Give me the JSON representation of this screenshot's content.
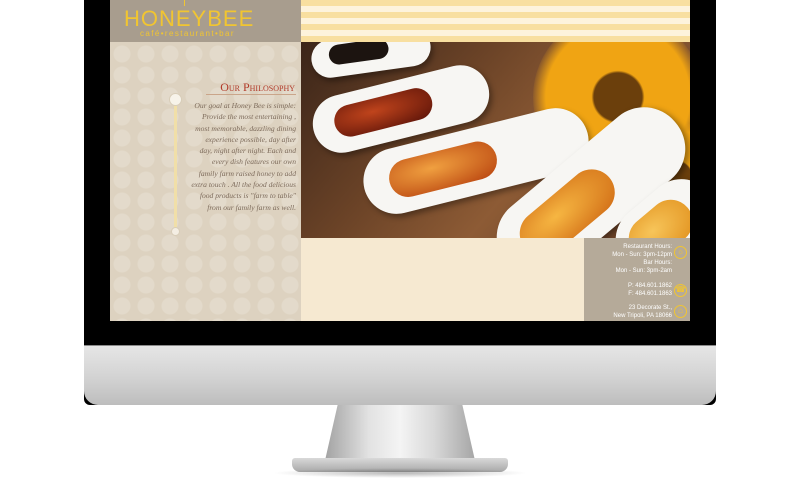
{
  "brand": {
    "name": "HONEYBEE",
    "tagline": "café•restaurant•bar",
    "accent_color": "#f1c531"
  },
  "philosophy": {
    "title": "Our Philosophy",
    "lines": [
      "Our goal at Honey Bee is simple:",
      "Provide the most entertaining ,",
      "most memorable, dazzling dining",
      "experience possible, day after",
      "day, night after night.  Each and",
      "every dish features our own",
      "family farm raised honey to add",
      "extra touch . All the food delicious",
      "food products is \"farm to table\"",
      "from our family farm as well."
    ]
  },
  "info": {
    "restaurant_hours_label": "Restaurant Hours:",
    "restaurant_hours": "Mon - Sun: 3pm-12pm",
    "bar_hours_label": "Bar Hours:",
    "bar_hours": "Mon - Sun: 3pm-2am",
    "phone": "P: 484.601.1862",
    "fax": "F: 484.601.1863",
    "address_line1": "23 Decorate St.,",
    "address_line2": "New Tripoli, PA 18066"
  },
  "icons": {
    "hours": "clock-icon",
    "phone": "phone-icon",
    "address": "home-icon"
  }
}
